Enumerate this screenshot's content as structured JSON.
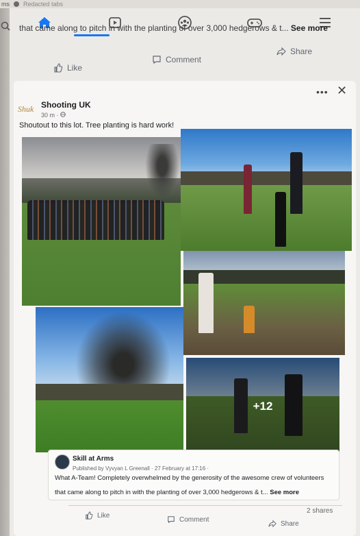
{
  "browser": {
    "tab_text": "ms",
    "tab_title": "Redacted tabs"
  },
  "nav": {
    "items": [
      {
        "name": "home",
        "icon": "home-icon",
        "active": true
      },
      {
        "name": "watch",
        "icon": "video-icon"
      },
      {
        "name": "groups",
        "icon": "groups-icon"
      },
      {
        "name": "gaming",
        "icon": "gamepad-icon"
      },
      {
        "name": "menu",
        "icon": "menu-icon"
      }
    ],
    "accent": "#1877f2"
  },
  "prev_post": {
    "text": "that came along to pitch in with the planting of over 3,000 hedgerows & t...",
    "see_more": "See more",
    "like": "Like",
    "comment": "Comment",
    "share": "Share"
  },
  "post": {
    "page_name": "Shooting UK",
    "avatar_text": "Shuk",
    "time": "30 m ·",
    "text": "Shoutout to this lot. Tree planting is hard work!",
    "more_photos": "+12",
    "shared": {
      "name": "Skill at Arms",
      "meta": "Published by Vyvyan L Greenall · 27 February at 17:16 ·",
      "text_line1": "What A-Team! Completely overwhelmed by the generosity of the awesome crew of volunteers",
      "text_line2": "that came along to pitch in with the planting of over 3,000 hedgerows & t...",
      "see_more": "See more"
    },
    "shares": "2 shares",
    "like": "Like",
    "comment": "Comment",
    "share": "Share"
  }
}
